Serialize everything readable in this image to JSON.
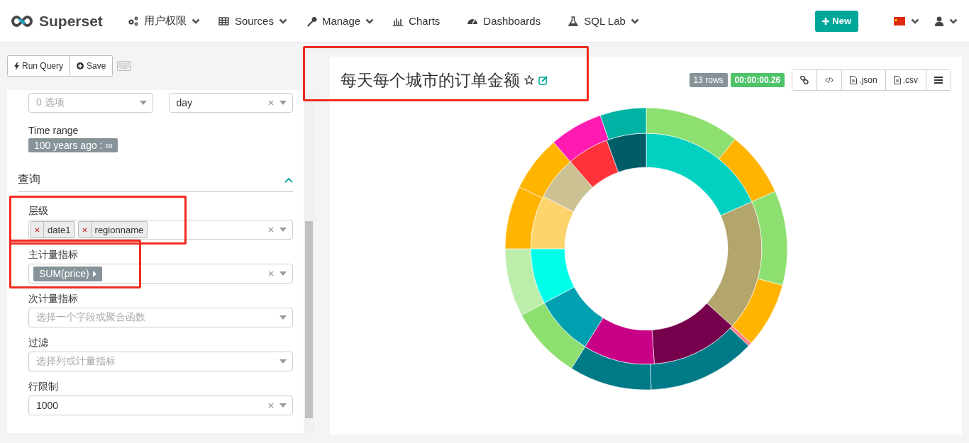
{
  "navbar": {
    "brand": "Superset",
    "menu": [
      {
        "label": "用户权限",
        "dropdown": true
      },
      {
        "label": "Sources",
        "dropdown": true
      },
      {
        "label": "Manage",
        "dropdown": true
      },
      {
        "label": "Charts",
        "dropdown": false
      },
      {
        "label": "Dashboards",
        "dropdown": false
      },
      {
        "label": "SQL Lab",
        "dropdown": true
      }
    ],
    "new_button": "New"
  },
  "sidebar": {
    "toolbar": [
      "Run Query",
      "Save"
    ],
    "time_fields": [
      {
        "placeholder": "0 选项",
        "clearable": false
      },
      {
        "value": "day",
        "clearable": true
      }
    ],
    "time_range": {
      "label": "Time range",
      "value": "100 years ago : ∞"
    },
    "section": {
      "title": "查询",
      "expanded": true
    },
    "controls": [
      {
        "kind": "tags",
        "label": "层级",
        "tags": [
          "date1",
          "regionname"
        ],
        "clearable": true,
        "highlighted": true
      },
      {
        "kind": "metric",
        "label": "主计量指标",
        "tags": [
          "SUM(price)"
        ],
        "clearable": true,
        "highlighted": true
      },
      {
        "kind": "select",
        "label": "次计量指标",
        "placeholder": "选择一个字段或聚合函数",
        "clearable": false,
        "highlighted": false
      },
      {
        "kind": "select",
        "label": "过滤",
        "placeholder": "选择列或计量指标",
        "clearable": false,
        "highlighted": false
      },
      {
        "kind": "select",
        "label": "行限制",
        "value": "1000",
        "clearable": true,
        "highlighted": false
      }
    ]
  },
  "chart_panel": {
    "title": "每天每个城市的订单金额",
    "favorite": false,
    "highlighted": true,
    "row_count": "13 rows",
    "duration": "00:00:00.26",
    "actions": [
      {
        "kind": "link"
      },
      {
        "kind": "embed"
      },
      {
        "kind": "json",
        "label": ".json"
      },
      {
        "kind": "csv",
        "label": ".csv"
      },
      {
        "kind": "menu"
      }
    ]
  }
}
